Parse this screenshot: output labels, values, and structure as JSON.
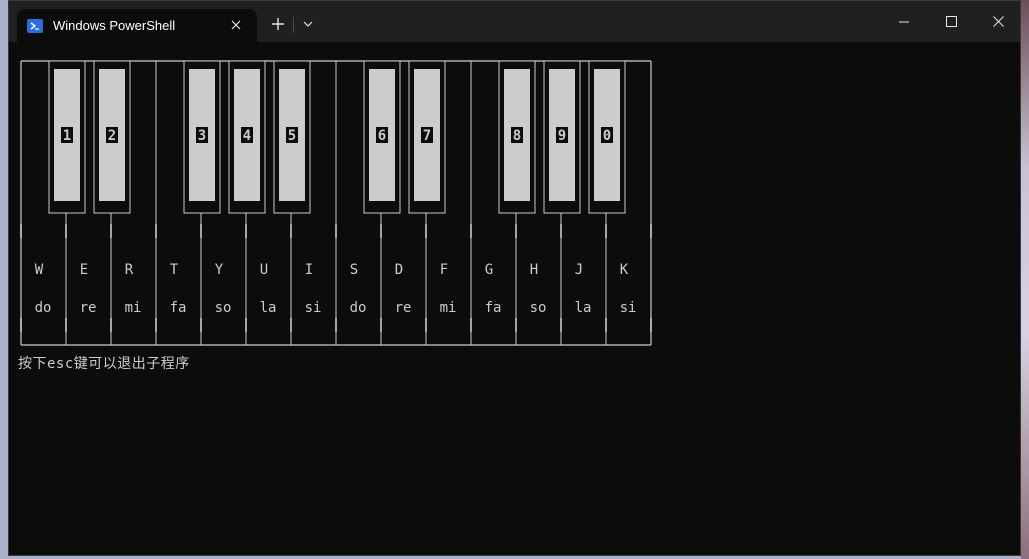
{
  "window": {
    "tab_title": "Windows PowerShell",
    "icons": {
      "tab": "powershell-icon",
      "close_tab": "close-icon",
      "new_tab": "plus-icon",
      "dropdown": "chevron-down-icon",
      "minimize": "minimize-icon",
      "maximize": "maximize-icon",
      "close": "close-icon"
    }
  },
  "piano": {
    "black_keys": [
      "1",
      "2",
      "3",
      "4",
      "5",
      "6",
      "7",
      "8",
      "9",
      "0"
    ],
    "white_keys": [
      {
        "key": "W",
        "note": "do"
      },
      {
        "key": "E",
        "note": "re"
      },
      {
        "key": "R",
        "note": "mi"
      },
      {
        "key": "T",
        "note": "fa"
      },
      {
        "key": "Y",
        "note": "so"
      },
      {
        "key": "U",
        "note": "la"
      },
      {
        "key": "I",
        "note": "si"
      },
      {
        "key": "S",
        "note": "do"
      },
      {
        "key": "D",
        "note": "re"
      },
      {
        "key": "F",
        "note": "mi"
      },
      {
        "key": "G",
        "note": "fa"
      },
      {
        "key": "H",
        "note": "so"
      },
      {
        "key": "J",
        "note": "la"
      },
      {
        "key": "K",
        "note": "si"
      }
    ]
  },
  "terminal": {
    "hint": "按下esc键可以退出子程序"
  },
  "colors": {
    "terminal_bg": "#0c0c0c",
    "titlebar_bg": "#202020",
    "text": "#cccccc",
    "black_key_fill": "#cccccc",
    "black_key_label_bg": "#0c0c0c"
  }
}
